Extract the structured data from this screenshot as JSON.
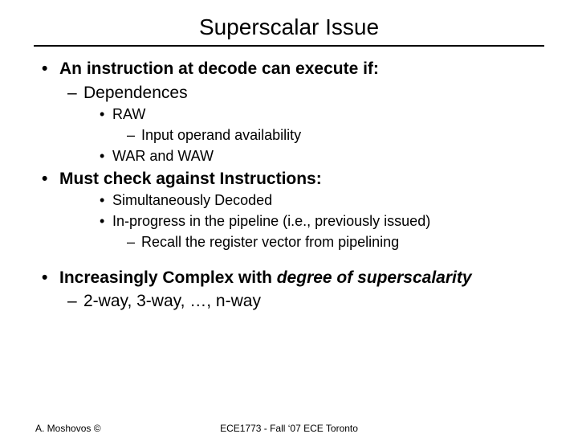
{
  "title": "Superscalar Issue",
  "bullets": {
    "b1": "An instruction at decode can execute if:",
    "b1_1": "Dependences",
    "b1_1_1": "RAW",
    "b1_1_1_1": "Input operand availability",
    "b1_1_2": "WAR and WAW",
    "b2": "Must check against Instructions:",
    "b2_1": "Simultaneously Decoded",
    "b2_2": "In-progress in the pipeline (i.e., previously issued)",
    "b2_2_1": "Recall the register vector from pipelining",
    "b3_a": "Increasingly Complex with ",
    "b3_b": "degree of superscalarity",
    "b3_1": "2-way, 3-way, …, n-way"
  },
  "footer": {
    "left": "A. Moshovos ©",
    "center": "ECE1773 - Fall ‘07 ECE Toronto"
  }
}
